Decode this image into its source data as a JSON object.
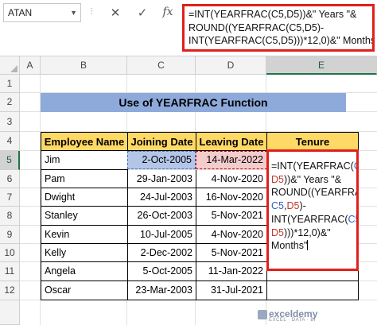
{
  "formula_bar": {
    "name_box": "ATAN",
    "separator": "⋮",
    "cancel_icon": "✕",
    "enter_icon": "✓",
    "fx_icon": "fx",
    "formula_text": "=INT(YEARFRAC(C5,D5))&\" Years \"&\nROUND((YEARFRAC(C5,D5)-\nINT(YEARFRAC(C5,D5)))*12,0)&\" Months\""
  },
  "columns": [
    "A",
    "B",
    "C",
    "D",
    "E"
  ],
  "active_column": "E",
  "rows": [
    "1",
    "2",
    "3",
    "4",
    "5",
    "6",
    "7",
    "8",
    "9",
    "10",
    "11",
    "12"
  ],
  "active_row": "5",
  "sheet": {
    "title": "Use of YEARFRAC Function",
    "headers": {
      "name": "Employee Name",
      "joining": "Joining Date",
      "leaving": "Leaving Date",
      "tenure": "Tenure"
    },
    "records": [
      {
        "name": "Jim",
        "joining": "2-Oct-2005",
        "leaving": "14-Mar-2022"
      },
      {
        "name": "Pam",
        "joining": "29-Jan-2003",
        "leaving": "4-Nov-2020"
      },
      {
        "name": "Dwight",
        "joining": "24-Jul-2003",
        "leaving": "16-Nov-2020"
      },
      {
        "name": "Stanley",
        "joining": "26-Oct-2003",
        "leaving": "5-Nov-2021"
      },
      {
        "name": "Kevin",
        "joining": "10-Jul-2005",
        "leaving": "4-Nov-2020"
      },
      {
        "name": "Kelly",
        "joining": "2-Dec-2002",
        "leaving": "5-Nov-2021"
      },
      {
        "name": "Angela",
        "joining": "5-Oct-2005",
        "leaving": "11-Jan-2022"
      },
      {
        "name": "Oscar",
        "joining": "23-Mar-2003",
        "leaving": "31-Jul-2021"
      }
    ],
    "editing_cell": {
      "p1": "=INT(YEARFRAC(",
      "c5a": "C5",
      "comma1": ",",
      "d5a": "D5",
      "p2": "))&\" Years \"&\nROUND((YEARFRAC(",
      "c5b": "C5",
      "comma2": ",",
      "d5b": "D5",
      "p3": ")-\nINT(YEARFRAC(",
      "c5c": "C5",
      "comma3": ",",
      "d5c": "D5",
      "p4": ")))*12,0)&\"\nMonths\""
    }
  },
  "watermark": {
    "brand": "exceldemy",
    "tagline": "EXCEL · DATA · BI"
  },
  "colors": {
    "title_fill": "#8eaadb",
    "header_fill": "#ffd966",
    "highlight_border": "#e0201b",
    "c5_ref": "#2f5ec4",
    "d5_ref": "#c0392b"
  }
}
